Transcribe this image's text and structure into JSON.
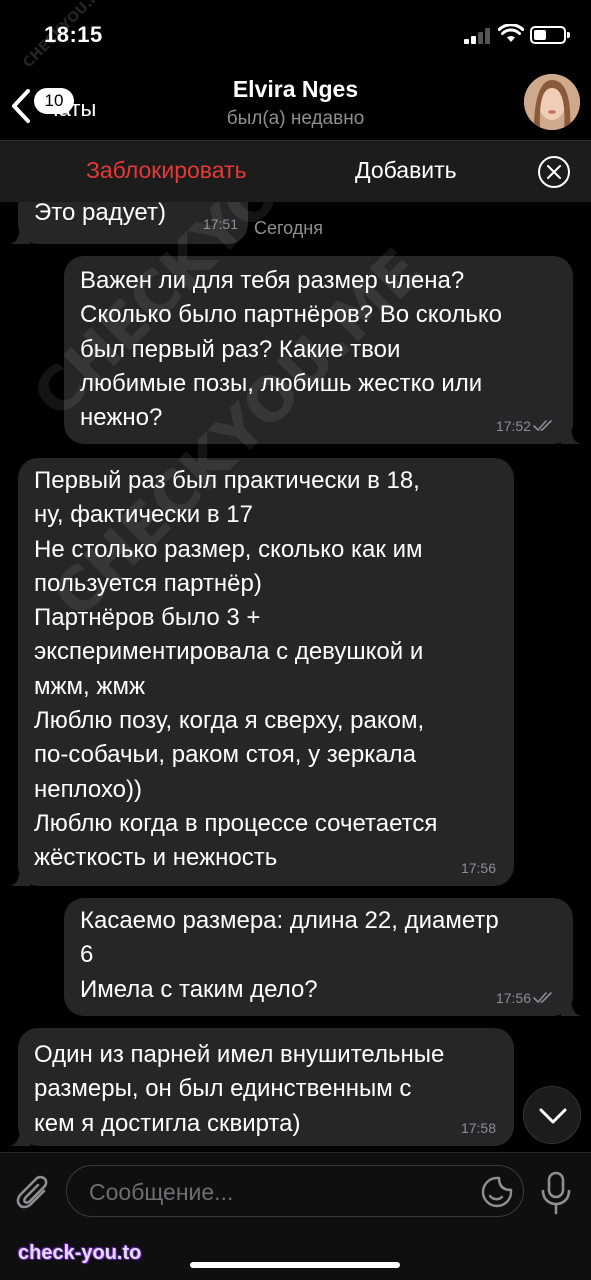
{
  "status_bar": {
    "time": "18:15"
  },
  "header": {
    "back_label": "Чаты",
    "unread_count": "10",
    "contact_name": "Elvira Nges",
    "contact_status": "был(а) недавно"
  },
  "action_bar": {
    "block_label": "Заблокировать",
    "add_label": "Добавить"
  },
  "date_separator": "Сегодня",
  "messages": [
    {
      "direction": "in",
      "text": "Это радует)",
      "time": "17:51"
    },
    {
      "direction": "out",
      "text": "Важен ли для тебя размер члена?\nСколько было партнёров? Во сколько\nбыл первый раз? Какие твои\nлюбимые позы, любишь жестко или\nнежно?",
      "time": "17:52",
      "read": true
    },
    {
      "direction": "in",
      "text": "Первый раз был практически в 18,\nну, фактически в 17\nНе столько размер, сколько как им\nпользуется партнёр)\nПартнёров было 3 +\nэкспериментировала с девушкой и\nмжм, жмж\nЛюблю позу, когда я сверху, раком,\nпо-собачьи, раком стоя, у зеркала\nнеплохо))\nЛюблю когда в процессе сочетается\nжёсткость и нежность",
      "time": "17:56"
    },
    {
      "direction": "out",
      "text": "Касаемо размера: длина 22, диаметр\n6\nИмела с таким дело?",
      "time": "17:56",
      "read": true
    },
    {
      "direction": "in",
      "text": "Один из парней имел внушительные\nразмеры, он был единственным с\nкем я достигла сквирта)",
      "time": "17:58"
    }
  ],
  "composer": {
    "placeholder": "Сообщение..."
  },
  "watermarks": {
    "main": "CHECKYOU.ME",
    "small": "CHECKYOU.ME",
    "brand": "check-you.to"
  },
  "icons": {
    "back": "chevron-left-icon",
    "close": "close-circle-icon",
    "attach": "paperclip-icon",
    "sticker": "sticker-icon",
    "mic": "microphone-icon",
    "scroll": "chevron-down-icon",
    "read": "double-check-icon"
  },
  "colors": {
    "block": "#e53935",
    "bubble": "#262628",
    "background": "#000000"
  }
}
